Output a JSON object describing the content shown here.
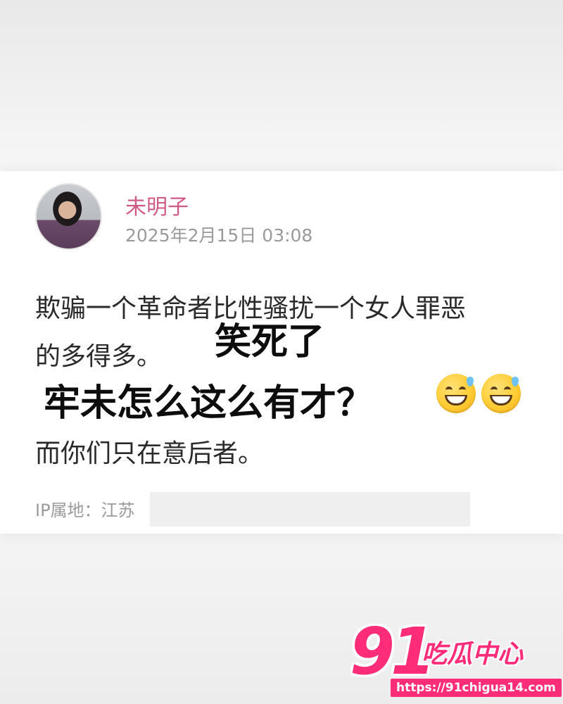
{
  "post": {
    "username": "未明子",
    "timestamp": "2025年2月15日 03:08",
    "body_lines": [
      "欺骗一个革命者比性骚扰一个女人罪恶",
      "的多得多。",
      "而你们只在意后者。"
    ],
    "ip_location": "IP属地：江苏"
  },
  "overlay_text": {
    "line1": "笑死了",
    "line2": "牢未怎么这么有才？"
  },
  "emojis": [
    "grinning-sweat-emoji",
    "grinning-sweat-emoji"
  ],
  "watermark": {
    "number": "91",
    "name": "吃瓜中心",
    "url": "https://91chigua14.com"
  },
  "colors": {
    "username": "#d05a87",
    "watermark": "#ff2d79"
  }
}
